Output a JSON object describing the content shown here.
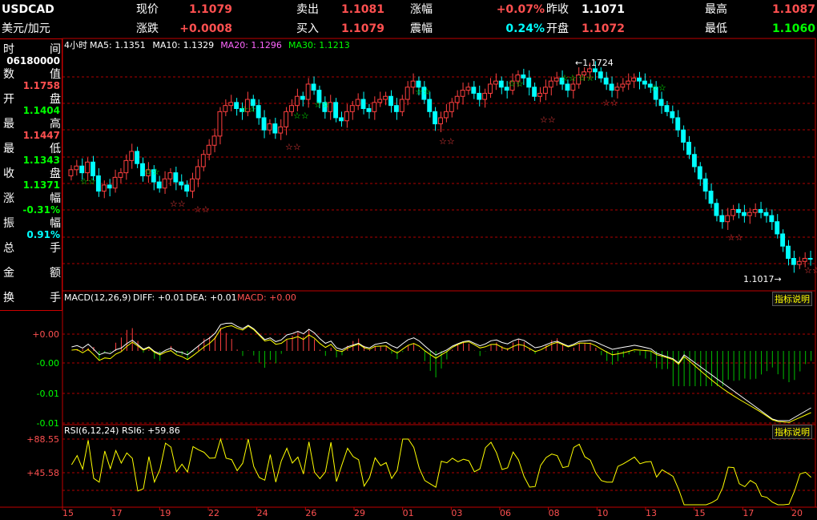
{
  "header": {
    "symbol": "USDCAD",
    "symbol_cn": "美元/加元",
    "cells": [
      {
        "label": "现价",
        "value": "1.1079",
        "color": "r"
      },
      {
        "label": "卖出",
        "value": "1.1081",
        "color": "r"
      },
      {
        "label": "涨幅",
        "value": "+0.07%",
        "color": "r"
      },
      {
        "label": "昨收",
        "value": "1.1071",
        "color": "w"
      },
      {
        "label": "最高",
        "value": "1.1087",
        "color": "r"
      },
      {
        "label": "涨跌",
        "value": "+0.0008",
        "color": "r"
      },
      {
        "label": "买入",
        "value": "1.1079",
        "color": "r"
      },
      {
        "label": "震幅",
        "value": "0.24%",
        "color": "c"
      },
      {
        "label": "开盘",
        "value": "1.1072",
        "color": "r"
      },
      {
        "label": "最低",
        "value": "1.1060",
        "color": "g"
      }
    ]
  },
  "sidebar": {
    "rows": [
      {
        "l": "时",
        "r": "间",
        "v": "06180000",
        "vc": "#ffffff"
      },
      {
        "l": "数",
        "r": "值",
        "v": "1.1758",
        "vc": "#ff5050"
      },
      {
        "l": "开",
        "r": "盘",
        "v": "1.1404",
        "vc": "#00ff00"
      },
      {
        "l": "最",
        "r": "高",
        "v": "1.1447",
        "vc": "#ff5050"
      },
      {
        "l": "最",
        "r": "低",
        "v": "1.1343",
        "vc": "#00ff00"
      },
      {
        "l": "收",
        "r": "盘",
        "v": "1.1371",
        "vc": "#00ff00"
      },
      {
        "l": "涨",
        "r": "幅",
        "v": "-0.31%",
        "vc": "#00ff00"
      },
      {
        "l": "振",
        "r": "幅",
        "v": "0.91%",
        "vc": "#00ffff"
      },
      {
        "l": "总",
        "r": "手",
        "v": "-",
        "vc": "#ffffff"
      },
      {
        "l": "金",
        "r": "额",
        "v": "-",
        "vc": "#ffffff"
      },
      {
        "l": "换",
        "r": "手",
        "v": "-",
        "vc": "#ffffff"
      }
    ]
  },
  "price_panel": {
    "period": "4小时",
    "ma": [
      {
        "text": "MA5: 1.1351",
        "color": "#ffffff"
      },
      {
        "text": "MA10: 1.1329",
        "color": "#ffffff"
      },
      {
        "text": "MA20: 1.1296",
        "color": "#ff66ff"
      },
      {
        "text": "MA30: 1.1213",
        "color": "#00ff00"
      }
    ],
    "high_label": "1.1724",
    "low_label": "1.1017"
  },
  "macd_panel": {
    "title": "MACD(12,26,9)",
    "diff": "DIFF: +0.01",
    "dea": "DEA: +0.01",
    "macd": "MACD: +0.00",
    "button": "指标说明",
    "yticks": [
      "+0.00",
      "-0.00",
      "-0.01",
      "-0.01"
    ]
  },
  "rsi_panel": {
    "title": "RSI(6,12,24)",
    "rsi6": "RSI6: +59.86",
    "button": "指标说明",
    "yticks": [
      "+88.55",
      "+45.58"
    ]
  },
  "xaxis": [
    "15",
    "17",
    "19",
    "22",
    "24",
    "26",
    "29",
    "01",
    "03",
    "06",
    "08",
    "10",
    "13",
    "15",
    "17",
    "20"
  ],
  "colors": {
    "up": "#ff4040",
    "down": "#00ffff",
    "grid": "#b00000",
    "axis": "#c00000"
  },
  "chart_data": {
    "type": "candlestick",
    "closes": [
      1.137,
      1.1382,
      1.136,
      1.1395,
      1.135,
      1.13,
      1.132,
      1.131,
      1.1345,
      1.136,
      1.14,
      1.143,
      1.139,
      1.135,
      1.137,
      1.133,
      1.131,
      1.134,
      1.136,
      1.133,
      1.132,
      1.13,
      1.134,
      1.138,
      1.142,
      1.145,
      1.148,
      1.156,
      1.158,
      1.159,
      1.157,
      1.156,
      1.16,
      1.158,
      1.154,
      1.15,
      1.152,
      1.149,
      1.151,
      1.156,
      1.158,
      1.161,
      1.16,
      1.165,
      1.163,
      1.159,
      1.156,
      1.159,
      1.154,
      1.153,
      1.156,
      1.158,
      1.16,
      1.157,
      1.156,
      1.159,
      1.16,
      1.161,
      1.158,
      1.156,
      1.16,
      1.164,
      1.166,
      1.164,
      1.16,
      1.156,
      1.152,
      1.154,
      1.156,
      1.159,
      1.161,
      1.163,
      1.164,
      1.162,
      1.16,
      1.162,
      1.165,
      1.166,
      1.164,
      1.163,
      1.166,
      1.168,
      1.167,
      1.164,
      1.161,
      1.162,
      1.164,
      1.166,
      1.167,
      1.165,
      1.163,
      1.165,
      1.168,
      1.169,
      1.17,
      1.169,
      1.167,
      1.165,
      1.163,
      1.164,
      1.165,
      1.166,
      1.167,
      1.166,
      1.165,
      1.164,
      1.16,
      1.158,
      1.156,
      1.154,
      1.15,
      1.146,
      1.142,
      1.138,
      1.134,
      1.13,
      1.126,
      1.122,
      1.12,
      1.122,
      1.124,
      1.123,
      1.122,
      1.123,
      1.124,
      1.123,
      1.122,
      1.12,
      1.116,
      1.112,
      1.108,
      1.106,
      1.107,
      1.108,
      1.1079
    ]
  }
}
